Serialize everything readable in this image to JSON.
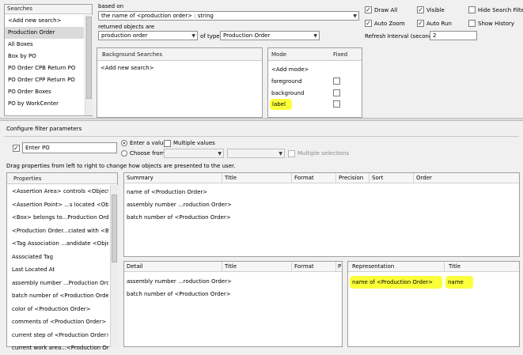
{
  "searches": {
    "header": "Searches",
    "items": [
      "<Add new search>",
      "Production Order",
      "All Boxes",
      "Box by PO",
      "PO Order CPB Return PO",
      "PO Order CPP Return PO",
      "PO Order Boxes",
      "PO by WorkCenter"
    ]
  },
  "based_on": {
    "label": "based on",
    "value": "the name of <production order> : string",
    "returned_label": "returned objects are",
    "returned_value": "production order",
    "of_type_label": "of type",
    "type_value": "Production Order"
  },
  "options": {
    "draw_all": "Draw All",
    "visible": "Visible",
    "hide_search_filter": "Hide Search Filter",
    "auto_zoom": "Auto Zoom",
    "auto_run": "Auto Run",
    "show_history": "Show History",
    "refresh_label": "Refresh Interval (seconds)",
    "refresh_value": "2"
  },
  "background_searches": {
    "header": "Background Searches",
    "items": [
      "<Add new search>"
    ]
  },
  "modes": {
    "col_mode": "Mode",
    "col_fixed": "Fixed",
    "items": [
      "<Add mode>",
      "foreground",
      "background",
      "label"
    ]
  },
  "filter": {
    "title": "Configure filter parameters",
    "enter_po_value": "Enter PO",
    "enter_value": "Enter a value",
    "multiple_values": "Multiple values",
    "choose_from": "Choose from",
    "multiple_selections": "Multiple selections",
    "hint": "Drag properties from left to right to change how objects are presented to the user."
  },
  "properties": {
    "header": "Properties",
    "items": [
      "<Assertion Area> controls <Object>",
      "<Assertion Point> ...s located <Object>",
      "<Box> belongs to...Production Order>",
      "<Production Order...ciated with <Box>",
      "<Tag Association ...andidate <Object>",
      "Associated Tag",
      "Last Located At",
      "assembly number ...Production Order>",
      "batch number of <Production Order>",
      "color of <Production Order>",
      "comments of <Production Order>",
      "current step of <Production Order>",
      "current work area...<Production Order>"
    ]
  },
  "summary": {
    "columns": [
      "Summary",
      "Title",
      "Format",
      "Precision",
      "Sort",
      "Order"
    ],
    "rows": [
      "name of <Production Order>",
      "assembly number ...roduction Order>",
      "batch number of <Production Order>"
    ]
  },
  "detail": {
    "columns": [
      "Detail",
      "Title",
      "Format",
      "P"
    ],
    "rows": [
      "assembly number ...roduction Order>",
      "batch number of <Production Order>"
    ]
  },
  "representation": {
    "columns": [
      "Representation",
      "Title"
    ],
    "rows": [
      {
        "rep": "name of <Production Order>",
        "title": "name"
      }
    ]
  },
  "colors": {
    "highlight": "#fbff3a",
    "panel_border": "#a0a0a0"
  }
}
